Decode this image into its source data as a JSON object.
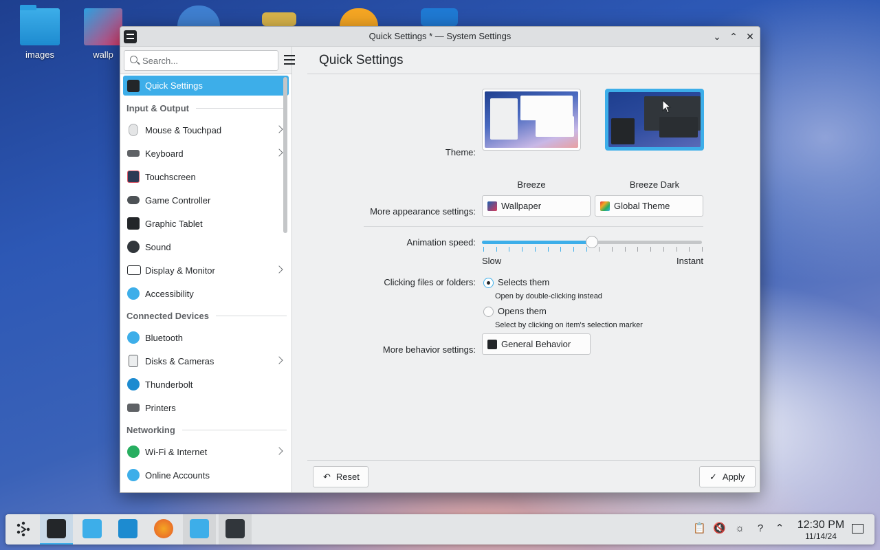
{
  "desktop": {
    "icons": [
      {
        "label": "images"
      },
      {
        "label": "wallp"
      }
    ]
  },
  "window": {
    "title": "Quick Settings * — System Settings"
  },
  "sidebar": {
    "search_placeholder": "Search...",
    "active_item": "Quick Settings",
    "sections": {
      "input_output": "Input & Output",
      "connected_devices": "Connected Devices",
      "networking": "Networking"
    },
    "items": {
      "mouse": "Mouse & Touchpad",
      "keyboard": "Keyboard",
      "touchscreen": "Touchscreen",
      "game_controller": "Game Controller",
      "graphic_tablet": "Graphic Tablet",
      "sound": "Sound",
      "display": "Display & Monitor",
      "accessibility": "Accessibility",
      "bluetooth": "Bluetooth",
      "disks": "Disks & Cameras",
      "thunderbolt": "Thunderbolt",
      "printers": "Printers",
      "wifi": "Wi-Fi & Internet",
      "online_accounts": "Online Accounts"
    }
  },
  "page": {
    "title": "Quick Settings",
    "theme_label": "Theme:",
    "themes": [
      {
        "name": "Breeze",
        "selected": false
      },
      {
        "name": "Breeze Dark",
        "selected": true
      }
    ],
    "more_appearance_label": "More appearance settings:",
    "wallpaper_button": "Wallpaper",
    "global_theme_button": "Global Theme",
    "animation_label": "Animation speed:",
    "animation_slow": "Slow",
    "animation_instant": "Instant",
    "animation_value": 0.5,
    "clicking_label": "Clicking files or folders:",
    "option_select": "Selects them",
    "option_select_hint": "Open by double-clicking instead",
    "option_open": "Opens them",
    "option_open_hint": "Select by clicking on item's selection marker",
    "more_behavior_label": "More behavior settings:",
    "general_behavior_button": "General Behavior"
  },
  "footer": {
    "reset": "Reset",
    "apply": "Apply"
  },
  "taskbar": {
    "time": "12:30 PM",
    "date": "11/14/24"
  },
  "colors": {
    "accent": "#3daee9",
    "window_bg": "#eff0f1"
  }
}
